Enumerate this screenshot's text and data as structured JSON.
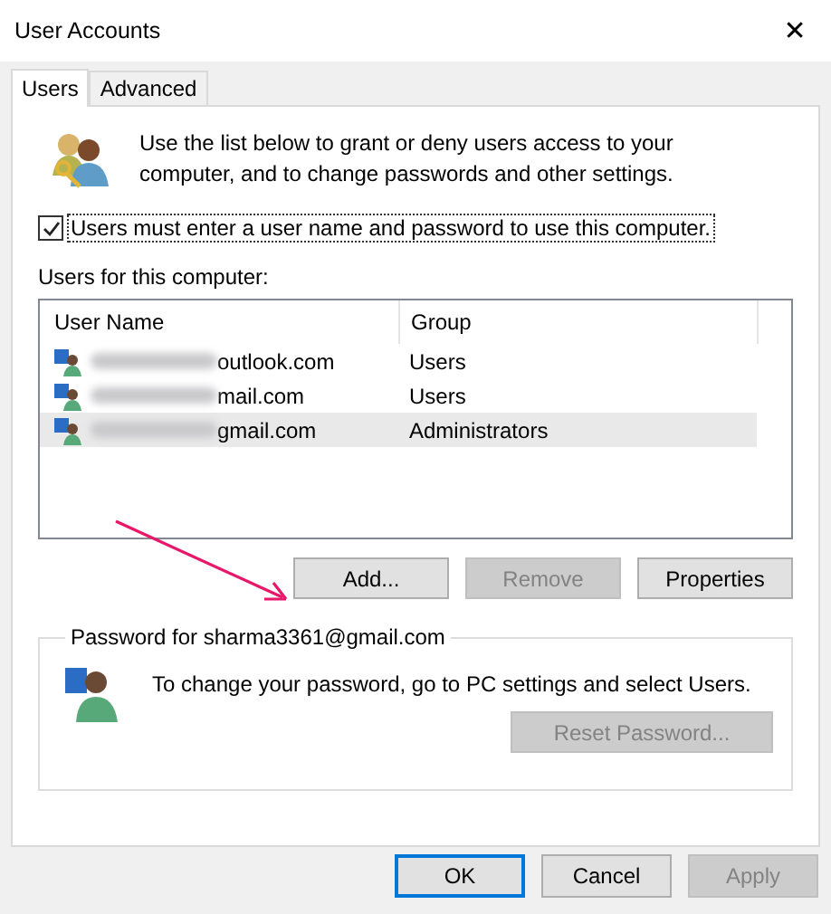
{
  "window": {
    "title": "User Accounts",
    "close": "✕"
  },
  "tabs": [
    {
      "label": "Users",
      "selected": true
    },
    {
      "label": "Advanced",
      "selected": false
    }
  ],
  "intro": "Use the list below to grant or deny users access to your computer, and to change passwords and other settings.",
  "require_login": {
    "label": "Users must enter a user name and password to use this computer.",
    "checked": true
  },
  "users_label": "Users for this computer:",
  "table": {
    "columns": [
      "User Name",
      "Group"
    ],
    "rows": [
      {
        "name": "outlook.com",
        "group": "Users",
        "selected": false
      },
      {
        "name": "mail.com",
        "group": "Users",
        "selected": false
      },
      {
        "name": "gmail.com",
        "group": "Administrators",
        "selected": true
      }
    ]
  },
  "list_buttons": [
    {
      "label": "Add...",
      "disabled": false
    },
    {
      "label": "Remove",
      "disabled": true
    },
    {
      "label": "Properties",
      "disabled": false
    }
  ],
  "password_group": {
    "title": "Password for sharma3361@gmail.com",
    "text": "To change your password, go to PC settings and select Users.",
    "button": {
      "label": "Reset Password...",
      "disabled": true
    }
  },
  "dialog_buttons": [
    {
      "label": "OK",
      "disabled": false,
      "default": true
    },
    {
      "label": "Cancel",
      "disabled": false,
      "default": false
    },
    {
      "label": "Apply",
      "disabled": true,
      "default": false
    }
  ]
}
